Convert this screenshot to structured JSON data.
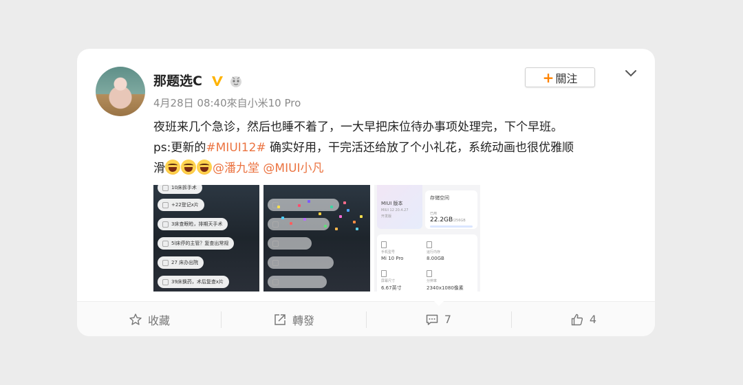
{
  "post": {
    "username": "那题选C",
    "meta": "4月28日 08:40來自小米10 Pro",
    "follow_label": "關注",
    "follow_plus": "+",
    "content": {
      "line1": "夜班来几个急诊，然后也睡不着了，一大早把床位待办事项处理完，下个早班。",
      "line2_prefix": "ps:更新的",
      "hashtag": "#MIUI12#",
      "line2_suffix": " 确实好用，干完活还给放了个小礼花，系统动画也很优雅顺",
      "line3_prefix": "滑",
      "mention1": "@潘九堂",
      "mention2": "@MIUI小凡"
    }
  },
  "images": {
    "tasks1": [
      "10床拆手术",
      "+22登记x片",
      "3床查眼睑，排期天手术",
      "5l床停的主管？复查出常规",
      "27 床办出院",
      "39床换药，术后复查x片"
    ],
    "settings": {
      "miui_label": "MIUI 版本",
      "miui_version": "MIUI 12 20.4.27",
      "miui_sub": "开发版",
      "storage_label": "存储空间",
      "storage_used_label": "已用",
      "storage_value": "22.2GB",
      "storage_total": "/256GB",
      "model_label": "手机型号",
      "model_value": "Mi 10 Pro",
      "ram_label": "运行内存",
      "ram_value": "8.00GB",
      "screen_label": "屏幕尺寸",
      "screen_value": "6.67英寸",
      "res_label": "分辨率",
      "res_value": "2340x1080像素"
    }
  },
  "footer": {
    "favorite_label": "收藏",
    "repost_label": "轉發",
    "comment_count": "7",
    "like_count": "4"
  },
  "colors": {
    "accent": "#eb7340",
    "follow_plus": "#ff8200",
    "verified": "#ffb300"
  }
}
